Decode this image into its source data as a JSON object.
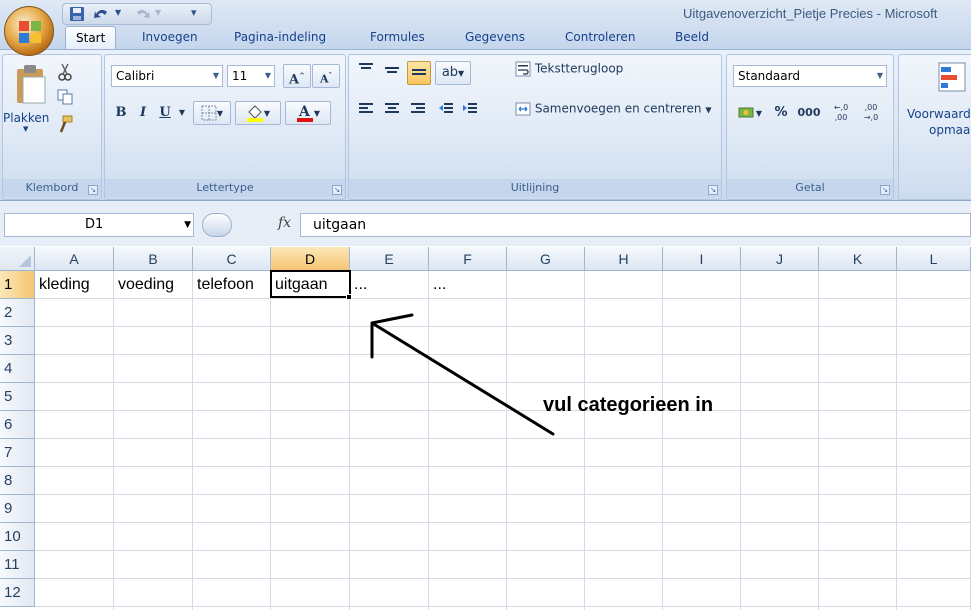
{
  "window": {
    "title": "Uitgavenoverzicht_Pietje Precies - Microsoft"
  },
  "tabs": [
    "Start",
    "Invoegen",
    "Pagina-indeling",
    "Formules",
    "Gegevens",
    "Controleren",
    "Beeld"
  ],
  "ribbon": {
    "clipboard": {
      "paste_label": "Plakken",
      "group_label": "Klembord"
    },
    "font": {
      "font_name": "Calibri",
      "font_size": "11",
      "bold": "B",
      "italic": "I",
      "underline": "U",
      "group_label": "Lettertype"
    },
    "alignment": {
      "wrap_label": "Tekstterugloop",
      "merge_label": "Samenvoegen en centreren",
      "group_label": "Uitlijning"
    },
    "number": {
      "format": "Standaard",
      "percent": "%",
      "thousands": "000",
      "group_label": "Getal"
    },
    "styles": {
      "conditional_label_1": "Voorwaard",
      "conditional_label_2": "opmaa"
    }
  },
  "formula_bar": {
    "name_box": "D1",
    "fx": "fx",
    "content": "uitgaan"
  },
  "grid": {
    "columns": [
      "A",
      "B",
      "C",
      "D",
      "E",
      "F",
      "G",
      "H",
      "I",
      "J",
      "K",
      "L"
    ],
    "rows": [
      "1",
      "2",
      "3",
      "4",
      "5",
      "6",
      "7",
      "8",
      "9",
      "10",
      "11",
      "12"
    ],
    "selected_column": "D",
    "selected_row": "1",
    "cells": {
      "A1": "kleding",
      "B1": "voeding",
      "C1": "telefoon",
      "D1": "uitgaan",
      "E1": "...",
      "F1": "..."
    }
  },
  "annotation": {
    "text": "vul categorieen in"
  }
}
